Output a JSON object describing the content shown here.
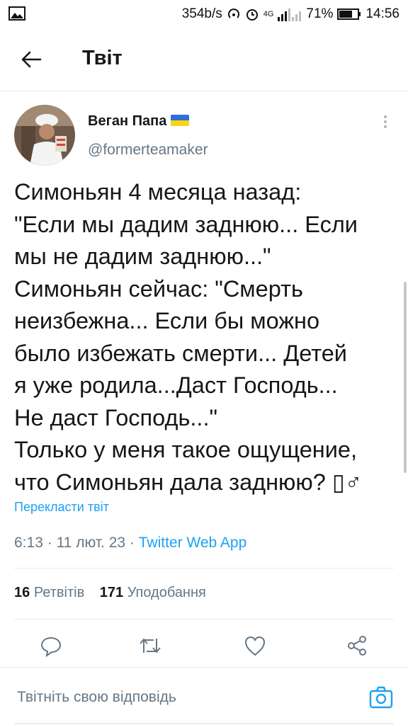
{
  "status_bar": {
    "speed": "354b/s",
    "network": "4G",
    "battery": "71%",
    "time": "14:56"
  },
  "header": {
    "title": "Твіт",
    "back_icon": "arrow-left-icon"
  },
  "author": {
    "name": "Веган Папа",
    "handle": "@formerteamaker",
    "flag": "ukraine-flag-icon"
  },
  "tweet": {
    "lines": [
      "Симоньян 4 месяца назад:",
      "\"Если мы дадим заднюю... Если",
      "мы не дадим заднюю...\"",
      "Симоньян сейчас: \"Смерть",
      "неизбежна... Если бы можно",
      "было избежать смерти... Детей",
      "я уже родила...Даст Господь...",
      "Не даст Господь...\"",
      "Только у меня такое ощущение,",
      "что Симоньян дала заднюю? ▯♂"
    ],
    "translate_label": "Перекласти твіт",
    "time": "6:13",
    "date": "11 лют. 23",
    "source": "Twitter Web App",
    "separator": "·"
  },
  "stats": {
    "retweets_count": "16",
    "retweets_label": "Ретвітів",
    "likes_count": "171",
    "likes_label": "Уподобання"
  },
  "actions": [
    "reply-icon",
    "retweet-icon",
    "like-icon",
    "share-icon"
  ],
  "reply": {
    "placeholder": "Твітніть свою відповідь",
    "camera_icon": "camera-icon"
  },
  "colors": {
    "accent": "#1da1f2",
    "text": "#14171a",
    "secondary": "#657786",
    "divider": "#e6ecf0"
  }
}
